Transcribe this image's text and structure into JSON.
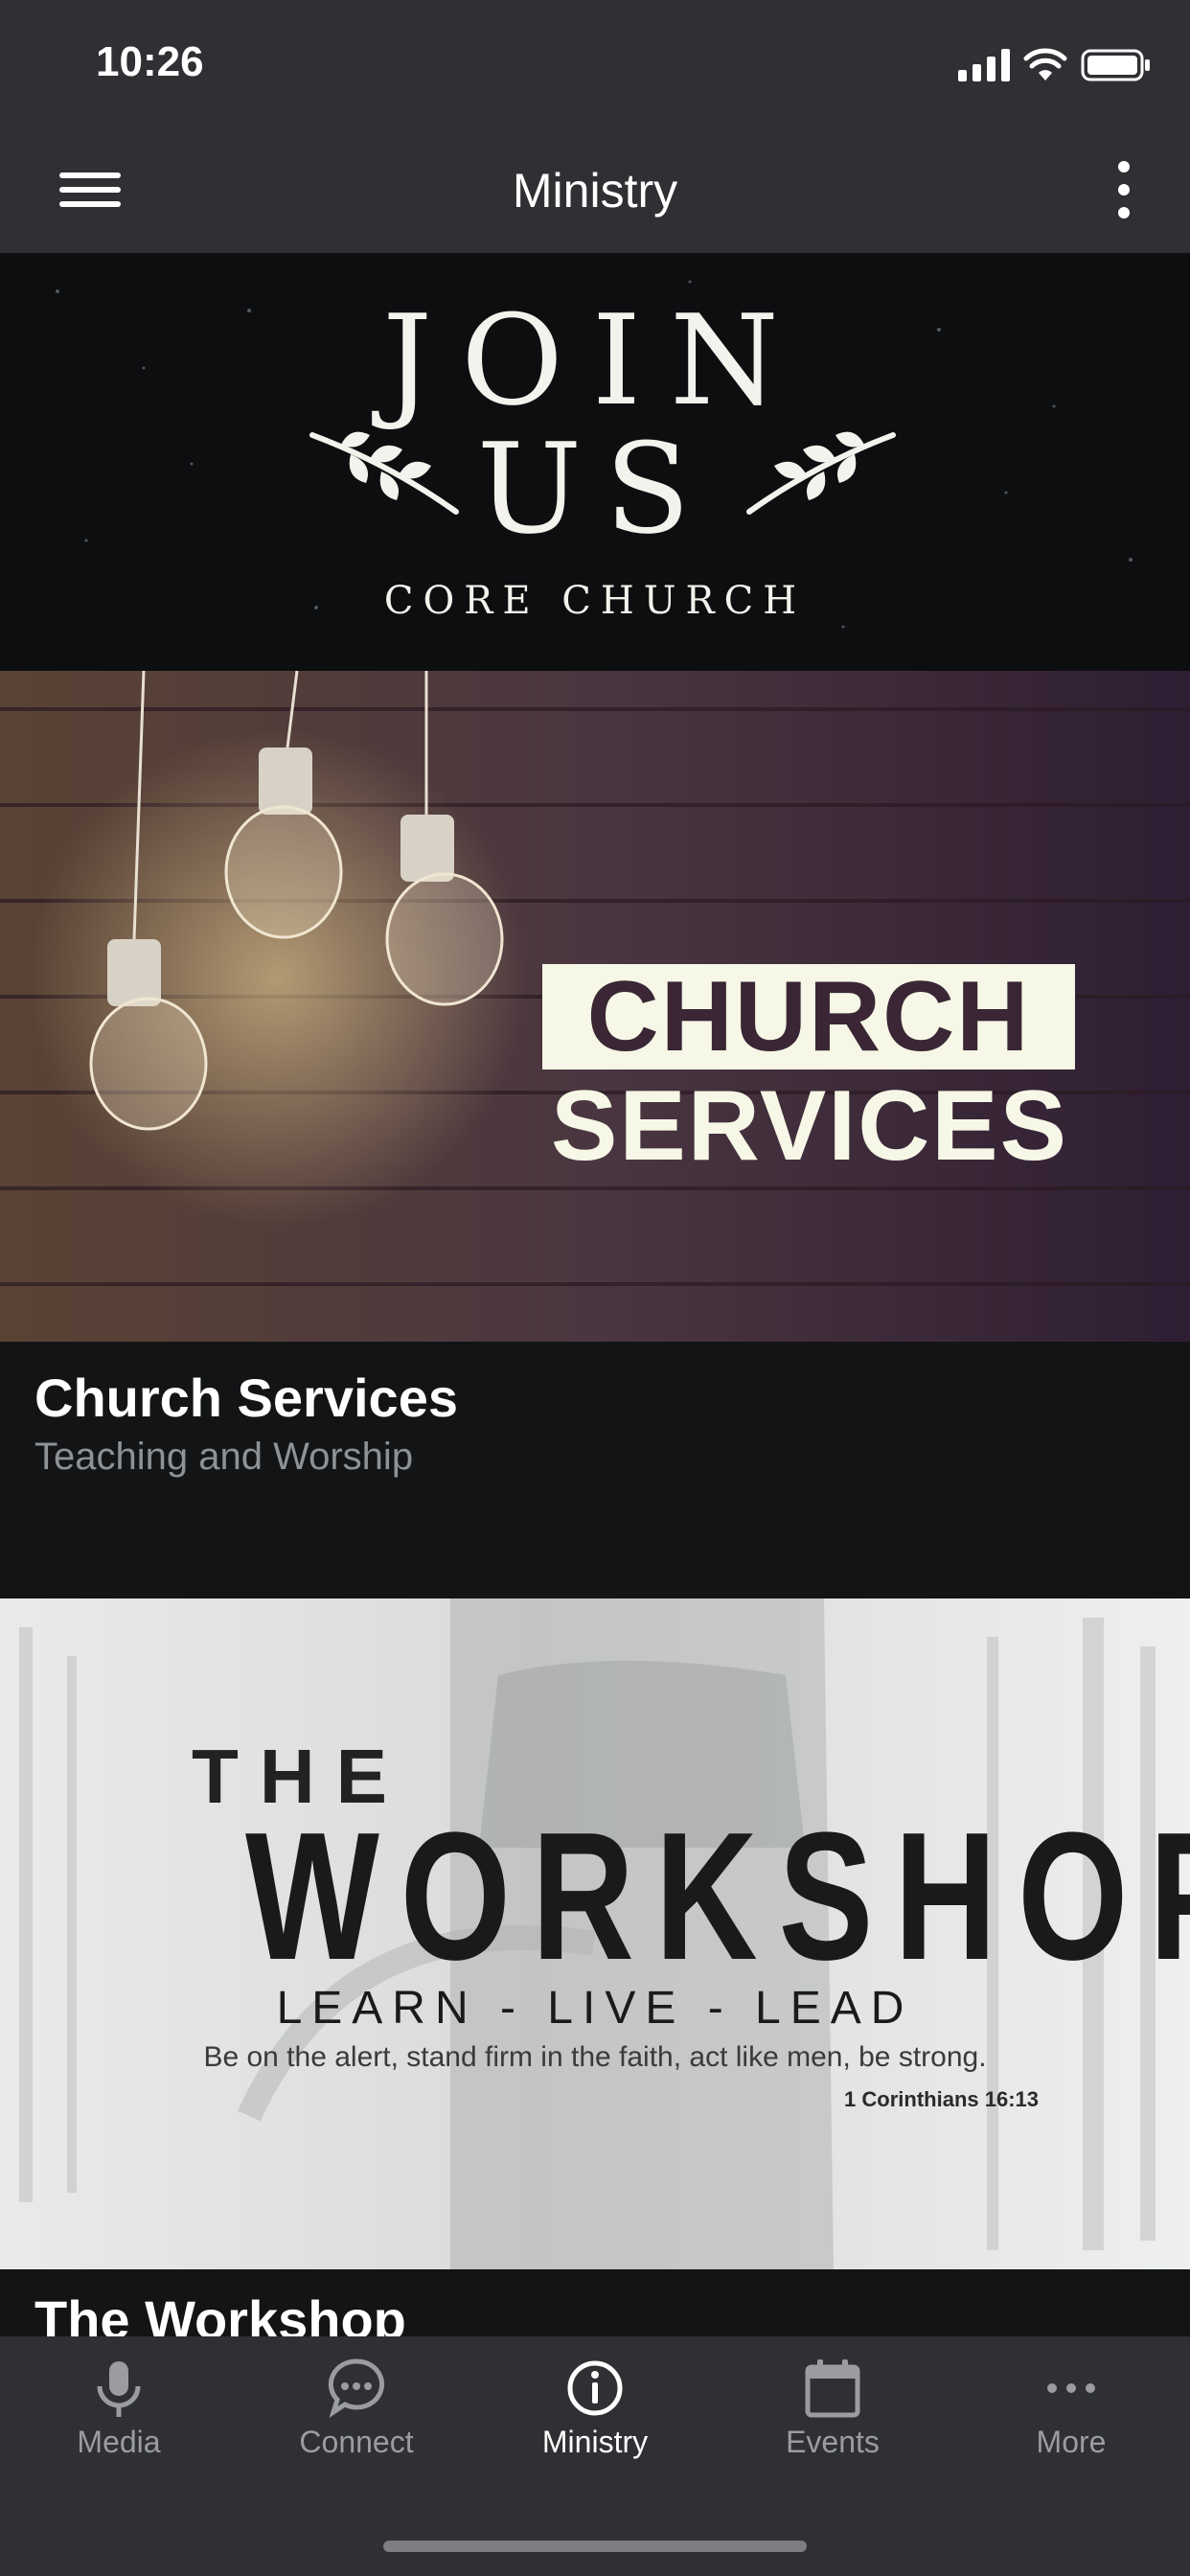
{
  "status_bar": {
    "time": "10:26"
  },
  "nav": {
    "title": "Ministry",
    "menu_icon": "hamburger-icon",
    "more_icon": "more-vertical-icon"
  },
  "banner": {
    "line1": "JOIN",
    "line2": "US",
    "subtitle": "CORE CHURCH"
  },
  "cards": [
    {
      "title": "Church Services",
      "subtitle": "Teaching and Worship",
      "image_text": {
        "word1": "CHURCH",
        "word2": "SERVICES"
      }
    },
    {
      "title": "The Workshop",
      "image_text": {
        "the": "THE",
        "main": "WORKSHOP",
        "tagline": "LEARN - LIVE - LEAD",
        "verse": "Be on the alert, stand firm in the faith, act like men, be strong.",
        "reference": "1 Corinthians 16:13"
      }
    }
  ],
  "tabs": [
    {
      "label": "Media",
      "icon": "microphone-icon",
      "active": false
    },
    {
      "label": "Connect",
      "icon": "chat-bubble-icon",
      "active": false
    },
    {
      "label": "Ministry",
      "icon": "info-icon",
      "active": true
    },
    {
      "label": "Events",
      "icon": "calendar-icon",
      "active": false
    },
    {
      "label": "More",
      "icon": "more-horizontal-icon",
      "active": false
    }
  ],
  "colors": {
    "bar_bg": "#2e3033",
    "content_bg": "#121416",
    "inactive_tab": "#9a9c9f",
    "active_tab": "#ffffff"
  }
}
